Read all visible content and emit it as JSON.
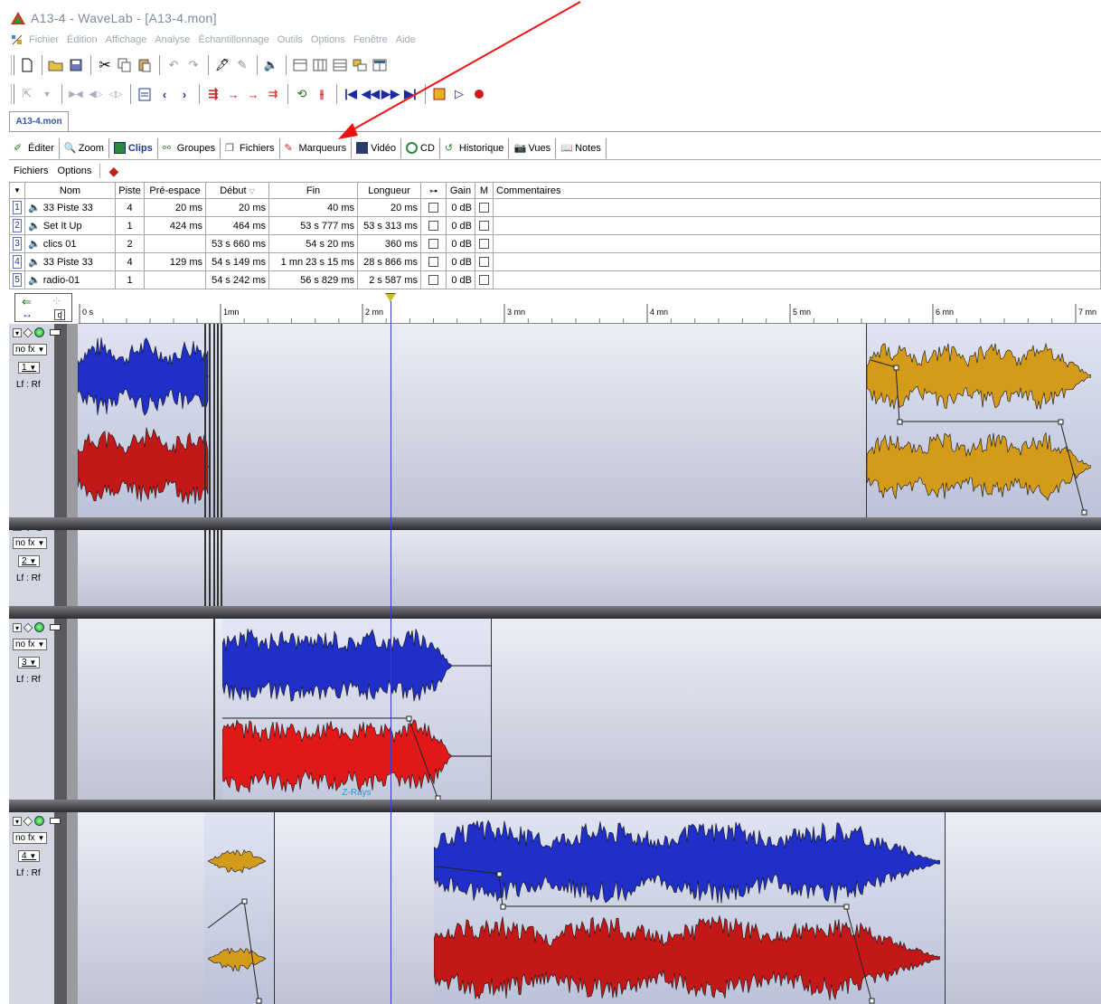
{
  "window": {
    "title": "A13-4 - WaveLab - [A13-4.mon]"
  },
  "menu": [
    "Fichier",
    "Édition",
    "Affichage",
    "Analyse",
    "Échantillonnage",
    "Outils",
    "Options",
    "Fenêtre",
    "Aide"
  ],
  "doc_tab": "A13-4.mon",
  "view_tabs": [
    {
      "label": "Éditer",
      "icon": "edit-icon"
    },
    {
      "label": "Zoom",
      "icon": "zoom-icon"
    },
    {
      "label": "Clips",
      "icon": "clips-icon",
      "active": true
    },
    {
      "label": "Groupes",
      "icon": "groups-icon"
    },
    {
      "label": "Fichiers",
      "icon": "files-icon"
    },
    {
      "label": "Marqueurs",
      "icon": "markers-icon"
    },
    {
      "label": "Vidéo",
      "icon": "video-icon"
    },
    {
      "label": "CD",
      "icon": "cd-icon"
    },
    {
      "label": "Historique",
      "icon": "history-icon"
    },
    {
      "label": "Vues",
      "icon": "views-icon"
    },
    {
      "label": "Notes",
      "icon": "notes-icon"
    }
  ],
  "submenu": [
    "Fichiers",
    "Options"
  ],
  "table": {
    "headers": [
      "Nom",
      "Piste",
      "Pré-espace",
      "Début",
      "Fin",
      "Longueur",
      "",
      "Gain",
      "M",
      "Commentaires"
    ],
    "rows": [
      {
        "num": "1",
        "name": "33 Piste 33",
        "track": "4",
        "pre": "20 ms",
        "start": "20 ms",
        "end": "40 ms",
        "length": "20 ms",
        "gain": "0 dB"
      },
      {
        "num": "2",
        "name": "Set It Up",
        "track": "1",
        "pre": "424 ms",
        "start": "464 ms",
        "end": "53 s 777 ms",
        "length": "53 s 313 ms",
        "gain": "0 dB"
      },
      {
        "num": "3",
        "name": "clics 01",
        "track": "2",
        "pre": "",
        "start": "53 s 660 ms",
        "end": "54 s 20 ms",
        "length": "360 ms",
        "gain": "0 dB"
      },
      {
        "num": "4",
        "name": "33 Piste 33",
        "track": "4",
        "pre": "129 ms",
        "start": "54 s 149 ms",
        "end": "1 mn 23 s 15 ms",
        "length": "28 s 866 ms",
        "gain": "0 dB"
      },
      {
        "num": "5",
        "name": "radio-01",
        "track": "1",
        "pre": "",
        "start": "54 s 242 ms",
        "end": "56 s 829 ms",
        "length": "2 s 587 ms",
        "gain": "0 dB"
      }
    ]
  },
  "ruler": {
    "ticks": [
      "0 s",
      "1mn",
      "2 mn",
      "3 mn",
      "4 mn",
      "5 mn",
      "6 mn",
      "7 mn"
    ]
  },
  "tracks": [
    {
      "number": "1",
      "fx": "no fx",
      "io": "Lf : Rf"
    },
    {
      "number": "2",
      "fx": "no fx",
      "io": "Lf : Rf"
    },
    {
      "number": "3",
      "fx": "no fx",
      "io": "Lf : Rf"
    },
    {
      "number": "4",
      "fx": "no fx",
      "io": "Lf : Rf"
    }
  ],
  "clips": {
    "z_rays": "Z-Rays"
  },
  "colors": {
    "left_blue": "#1f2fc8",
    "right_red": "#c41818",
    "gold": "#d49a1a",
    "cursor": "#2a2ac0",
    "annotation": "#ee1111"
  }
}
